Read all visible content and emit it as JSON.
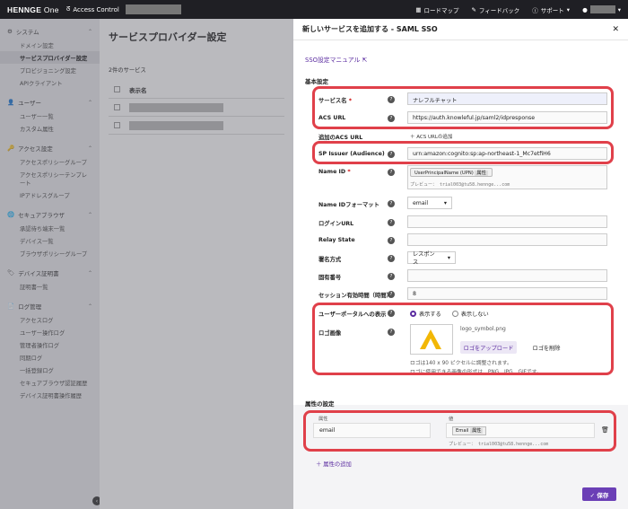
{
  "topbar": {
    "brand": "HENNGE",
    "brand_suffix": " One",
    "app_title": "Access Control",
    "roadmap": "ロードマップ",
    "feedback": "フィードバック",
    "support": "サポート"
  },
  "sidebar": {
    "sections": [
      {
        "label": "システム",
        "items": [
          "ドメイン設定",
          "サービスプロバイダー設定",
          "プロビジョニング設定",
          "APIクライアント"
        ]
      },
      {
        "label": "ユーザー",
        "items": [
          "ユーザー一覧",
          "カスタム属性"
        ]
      },
      {
        "label": "アクセス設定",
        "items": [
          "アクセスポリシーグループ",
          "アクセスポリシーテンプレート",
          "IPアドレスグループ"
        ]
      },
      {
        "label": "セキュアブラウザ",
        "items": [
          "承認待ち端末一覧",
          "デバイス一覧",
          "ブラウザポリシーグループ"
        ]
      },
      {
        "label": "デバイス証明書",
        "items": [
          "証明書一覧"
        ]
      },
      {
        "label": "ログ管理",
        "items": [
          "アクセスログ",
          "ユーザー操作ログ",
          "管理者操作ログ",
          "同期ログ",
          "一括登録ログ",
          "セキュアブラウザ認証履歴",
          "デバイス証明書操作履歴"
        ]
      }
    ]
  },
  "main": {
    "title": "サービスプロバイダー設定",
    "count": "2件のサービス",
    "col_display_name": "表示名"
  },
  "panel": {
    "title": "新しいサービスを追加する - SAML SSO",
    "manual_link": "SSO設定マニュアル",
    "basic_settings": "基本設定",
    "fields": {
      "service_name_label": "サービス名",
      "required_mark": "*",
      "service_name_value": "ナレフルチャット",
      "acs_url_label": "ACS URL",
      "acs_url_value": "https://auth.knowleful.jp/saml2/idpresponse",
      "add_acs_label": "追加のACS URL",
      "add_acs_button": "＋ ACS URLの追加",
      "sp_issuer_label": "SP Issuer (Audience)",
      "sp_issuer_value": "urn:amazon:cognito:sp:ap-northeast-1_Mc7etfiH6",
      "name_id_label": "Name ID",
      "name_id_pill": "UserPrincipalName (UPN)",
      "name_id_pill_tag": "属性",
      "name_id_preview": "プレビュー： trial003@tu58.hennge...com",
      "name_id_format_label": "Name IDフォーマット",
      "name_id_format_value": "email",
      "login_url_label": "ログインURL",
      "relay_state_label": "Relay State",
      "sign_method_label": "署名方式",
      "sign_method_value": "レスポンス",
      "unique_number_label": "固有番号",
      "session_label": "セッション有効時間（時間）",
      "session_value": "8",
      "portal_label": "ユーザーポータルへの表示",
      "portal_show": "表示する",
      "portal_hide": "表示しない",
      "logo_label": "ロゴ画像",
      "logo_filename": "logo_symbol.png",
      "logo_upload": "ロゴをアップロード",
      "logo_delete": "ロゴを削除",
      "logo_note1": "ロゴは140 x 90 ピクセルに調整されます。",
      "logo_note2": "ロゴに使用できる画像の形式は、PNG、JPG、GIFです。"
    },
    "attr_settings": "属性の設定",
    "attr_col_attr": "属性",
    "attr_col_value": "値",
    "attr_name_value": "email",
    "attr_value_pill": "Email",
    "attr_value_pill_tag": "属性",
    "attr_preview": "プレビュー： trial003@tu58.hennge...com",
    "add_attr": "＋ 属性の追加",
    "save": "✓ 保存"
  },
  "colors": {
    "accent": "#6b3fb6",
    "highlight": "#e0404a"
  }
}
